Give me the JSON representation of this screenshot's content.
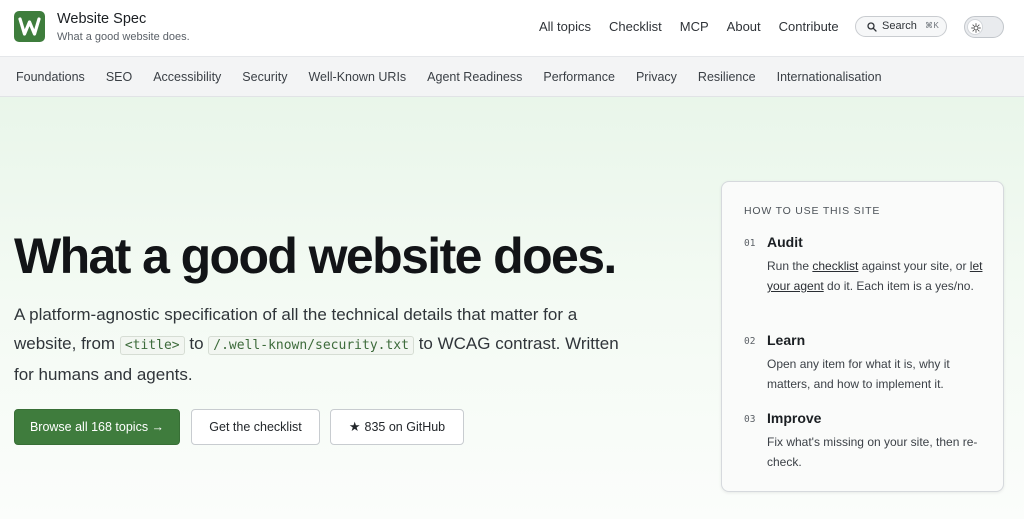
{
  "brand": {
    "name": "Website Spec",
    "tagline": "What a good website does.",
    "accent": "#3e7d3c"
  },
  "top_nav": [
    "All topics",
    "Checklist",
    "MCP",
    "About",
    "Contribute"
  ],
  "search": {
    "label": "Search",
    "shortcut": "⌘K"
  },
  "categories": [
    "Foundations",
    "SEO",
    "Accessibility",
    "Security",
    "Well-Known URIs",
    "Agent Readiness",
    "Performance",
    "Privacy",
    "Resilience",
    "Internationalisation"
  ],
  "hero": {
    "title": "What a good website does.",
    "desc_part1": "A platform-agnostic specification of all the technical details that matter for a website, from",
    "code1": "<title>",
    "desc_part2": "to",
    "code2": "/.well-known/security.txt",
    "desc_part3": "to WCAG contrast. Written for humans and agents.",
    "buttons": {
      "primary": "Browse all 168 topics →",
      "checklist": "Get the checklist",
      "github": "835 on GitHub"
    }
  },
  "howto": {
    "title": "HOW TO USE THIS SITE",
    "steps": [
      {
        "num": "01",
        "head": "Audit",
        "pre": "Run the ",
        "link1": "checklist",
        "mid": " against your site, or ",
        "link2": "let your agent",
        "post": " do it. Each item is a yes/no."
      },
      {
        "num": "02",
        "head": "Learn",
        "body": "Open any item for what it is, why it matters, and how to implement it."
      },
      {
        "num": "03",
        "head": "Improve",
        "body": "Fix what's missing on your site, then re-check."
      }
    ]
  }
}
